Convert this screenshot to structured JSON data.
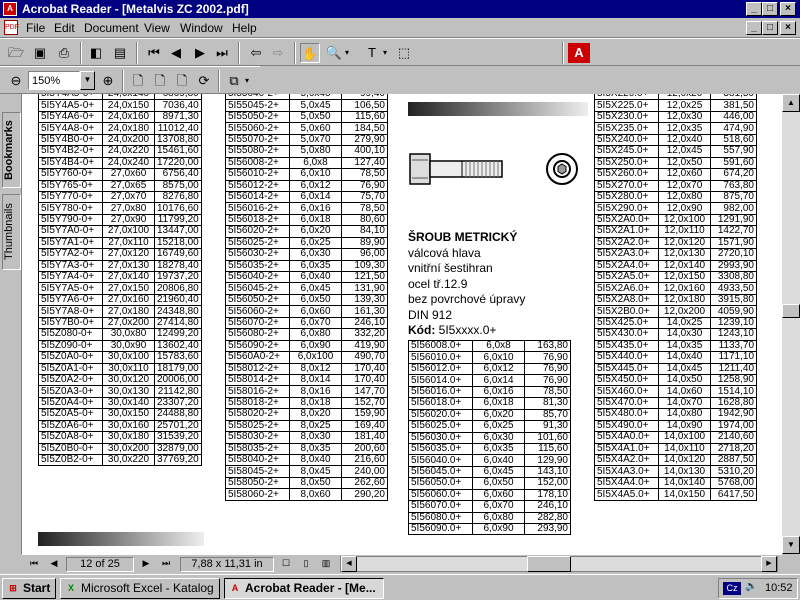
{
  "window": {
    "title": "Acrobat Reader - [Metalvis ZC 2002.pdf]"
  },
  "menu": [
    "File",
    "Edit",
    "Document",
    "View",
    "Window",
    "Help"
  ],
  "zoom": {
    "value": "150%"
  },
  "nav_tabs": [
    "Bookmarks",
    "Thumbnails"
  ],
  "status": {
    "page": "12 of 25",
    "size": "7,88 x 11,31 in"
  },
  "taskbar": {
    "start": "Start",
    "items": [
      "Microsoft Excel - Katalog",
      "Acrobat Reader - [Me..."
    ],
    "lang": "Cz",
    "time": "10:52"
  },
  "product": {
    "title": "ŠROUB METRICKÝ",
    "lines": [
      "válcová hlava",
      "vnitřní šestihran",
      "ocel tř.12.9",
      "bez povrchové úpravy",
      "DIN 912"
    ],
    "code_label": "Kód:",
    "code_value": "5I5xxxx.0+"
  },
  "col1": [
    [
      "5I5Y4A5-0+",
      "24,0x140",
      "6869,80"
    ],
    [
      "5I5Y4A5-0+",
      "24,0x150",
      "7036,40"
    ],
    [
      "5I5Y4A6-0+",
      "24,0x160",
      "8971,30"
    ],
    [
      "5I5Y4A8-0+",
      "24,0x180",
      "11012,40"
    ],
    [
      "5I5Y4B0-0+",
      "24,0x200",
      "13708,80"
    ],
    [
      "5I5Y4B2-0+",
      "24,0x220",
      "15461,60"
    ],
    [
      "5I5Y4B4-0+",
      "24,0x240",
      "17220,00"
    ],
    [
      "5I5Y760-0+",
      "27,0x60",
      "6756,40"
    ],
    [
      "5I5Y765-0+",
      "27,0x65",
      "8575,00"
    ],
    [
      "5I5Y770-0+",
      "27,0x70",
      "8276,80"
    ],
    [
      "5I5Y780-0+",
      "27,0x80",
      "10176,60"
    ],
    [
      "5I5Y790-0+",
      "27,0x90",
      "11799,20"
    ],
    [
      "5I5Y7A0-0+",
      "27,0x100",
      "13447,00"
    ],
    [
      "5I5Y7A1-0+",
      "27,0x110",
      "15218,00"
    ],
    [
      "5I5Y7A2-0+",
      "27,0x120",
      "16749,60"
    ],
    [
      "5I5Y7A3-0+",
      "27,0x130",
      "18278,40"
    ],
    [
      "5I5Y7A4-0+",
      "27,0x140",
      "19737,20"
    ],
    [
      "5I5Y7A5-0+",
      "27,0x150",
      "20806,80"
    ],
    [
      "5I5Y7A6-0+",
      "27,0x160",
      "21960,40"
    ],
    [
      "5I5Y7A8-0+",
      "27,0x180",
      "24348,80"
    ],
    [
      "5I5Y7B0-0+",
      "27,0x200",
      "27414,80"
    ],
    [
      "5I5Z080-0+",
      "30,0x80",
      "12499,20"
    ],
    [
      "5I5Z090-0+",
      "30,0x90",
      "13602,40"
    ],
    [
      "5I5Z0A0-0+",
      "30,0x100",
      "15783,60"
    ],
    [
      "5I5Z0A1-0+",
      "30,0x110",
      "18179,00"
    ],
    [
      "5I5Z0A2-0+",
      "30,0x120",
      "20006,00"
    ],
    [
      "5I5Z0A3-0+",
      "30,0x130",
      "21142,80"
    ],
    [
      "5I5Z0A4-0+",
      "30,0x140",
      "23307,20"
    ],
    [
      "5I5Z0A5-0+",
      "30,0x150",
      "24488,80"
    ],
    [
      "5I5Z0A6-0+",
      "30,0x160",
      "25701,20"
    ],
    [
      "5I5Z0A8-0+",
      "30,0x180",
      "31539,20"
    ],
    [
      "5I5Z0B0-0+",
      "30,0x200",
      "32879,00"
    ],
    [
      "5I5Z0B2-0+",
      "30,0x220",
      "37769,20"
    ]
  ],
  "col2": [
    [
      "5I55040-2+",
      "5,0x40",
      "99,40"
    ],
    [
      "5I55045-2+",
      "5,0x45",
      "106,50"
    ],
    [
      "5I55050-2+",
      "5,0x50",
      "115,60"
    ],
    [
      "5I55060-2+",
      "5,0x60",
      "184,50"
    ],
    [
      "5I55070-2+",
      "5,0x70",
      "279,90"
    ],
    [
      "5I55080-2+",
      "5,0x80",
      "400,10"
    ],
    [
      "5I56008-2+",
      "6,0x8",
      "127,40"
    ],
    [
      "5I56010-2+",
      "6,0x10",
      "78,50"
    ],
    [
      "5I56012-2+",
      "6,0x12",
      "76,90"
    ],
    [
      "5I56014-2+",
      "6,0x14",
      "75,70"
    ],
    [
      "5I56016-2+",
      "6,0x16",
      "78,50"
    ],
    [
      "5I56018-2+",
      "6,0x18",
      "80,60"
    ],
    [
      "5I56020-2+",
      "6,0x20",
      "84,10"
    ],
    [
      "5I56025-2+",
      "6,0x25",
      "89,90"
    ],
    [
      "5I56030-2+",
      "6,0x30",
      "96,00"
    ],
    [
      "5I56035-2+",
      "6,0x35",
      "109,30"
    ],
    [
      "5I56040-2+",
      "6,0x40",
      "121,50"
    ],
    [
      "5I56045-2+",
      "6,0x45",
      "131,90"
    ],
    [
      "5I56050-2+",
      "6,0x50",
      "139,30"
    ],
    [
      "5I56060-2+",
      "6,0x60",
      "161,30"
    ],
    [
      "5I56070-2+",
      "6,0x70",
      "246,10"
    ],
    [
      "5I56080-2+",
      "6,0x80",
      "332,20"
    ],
    [
      "5I56090-2+",
      "6,0x90",
      "419,90"
    ],
    [
      "5I560A0-2+",
      "6,0x100",
      "490,70"
    ],
    [
      "5I58012-2+",
      "8,0x12",
      "170,40"
    ],
    [
      "5I58014-2+",
      "8,0x14",
      "170,40"
    ],
    [
      "5I58016-2+",
      "8,0x16",
      "147,70"
    ],
    [
      "5I58018-2+",
      "8,0x18",
      "152,70"
    ],
    [
      "5I58020-2+",
      "8,0x20",
      "159,90"
    ],
    [
      "5I58025-2+",
      "8,0x25",
      "169,40"
    ],
    [
      "5I58030-2+",
      "8,0x30",
      "181,40"
    ],
    [
      "5I58035-2+",
      "8,0x35",
      "200,60"
    ],
    [
      "5I58040-2+",
      "8,0x40",
      "216,60"
    ],
    [
      "5I58045-2+",
      "8,0x45",
      "240,00"
    ],
    [
      "5I58050-2+",
      "8,0x50",
      "262,60"
    ],
    [
      "5I58060-2+",
      "8,0x60",
      "290,20"
    ]
  ],
  "col3": [
    [
      "5I56008.0+",
      "6,0x8",
      "163,80"
    ],
    [
      "5I56010.0+",
      "6,0x10",
      "76,90"
    ],
    [
      "5I56012.0+",
      "6,0x12",
      "76,90"
    ],
    [
      "5I56014.0+",
      "6,0x14",
      "76,90"
    ],
    [
      "5I56016.0+",
      "6,0x16",
      "78,50"
    ],
    [
      "5I56018.0+",
      "6,0x18",
      "81,30"
    ],
    [
      "5I56020.0+",
      "6,0x20",
      "85,70"
    ],
    [
      "5I56025.0+",
      "6,0x25",
      "91,30"
    ],
    [
      "5I56030.0+",
      "6,0x30",
      "101,60"
    ],
    [
      "5I56035.0+",
      "6,0x35",
      "115,60"
    ],
    [
      "5I56040.0+",
      "6,0x40",
      "129,90"
    ],
    [
      "5I56045.0+",
      "6,0x45",
      "143,10"
    ],
    [
      "5I56050.0+",
      "6,0x50",
      "152,00"
    ],
    [
      "5I56060.0+",
      "6,0x60",
      "178,10"
    ],
    [
      "5I56070.0+",
      "6,0x70",
      "246,10"
    ],
    [
      "5I56080.0+",
      "6,0x80",
      "282,80"
    ],
    [
      "5I56090.0+",
      "6,0x90",
      "293,90"
    ]
  ],
  "col4": [
    [
      "5I5X220.0+",
      "12,0x20",
      "381,50"
    ],
    [
      "5I5X225.0+",
      "12,0x25",
      "381,50"
    ],
    [
      "5I5X230.0+",
      "12,0x30",
      "446,00"
    ],
    [
      "5I5X235.0+",
      "12,0x35",
      "474,90"
    ],
    [
      "5I5X240.0+",
      "12,0x40",
      "518,60"
    ],
    [
      "5I5X245.0+",
      "12,0x45",
      "557,90"
    ],
    [
      "5I5X250.0+",
      "12,0x50",
      "591,60"
    ],
    [
      "5I5X260.0+",
      "12,0x60",
      "674,20"
    ],
    [
      "5I5X270.0+",
      "12,0x70",
      "763,80"
    ],
    [
      "5I5X280.0+",
      "12,0x80",
      "875,70"
    ],
    [
      "5I5X290.0+",
      "12,0x90",
      "982,00"
    ],
    [
      "5I5X2A0.0+",
      "12,0x100",
      "1291,90"
    ],
    [
      "5I5X2A1.0+",
      "12,0x110",
      "1422,70"
    ],
    [
      "5I5X2A2.0+",
      "12,0x120",
      "1571,90"
    ],
    [
      "5I5X2A3.0+",
      "12,0x130",
      "2720,10"
    ],
    [
      "5I5X2A4.0+",
      "12,0x140",
      "2993,90"
    ],
    [
      "5I5X2A5.0+",
      "12,0x150",
      "3308,80"
    ],
    [
      "5I5X2A6.0+",
      "12,0x160",
      "4933,50"
    ],
    [
      "5I5X2A8.0+",
      "12,0x180",
      "3915,80"
    ],
    [
      "5I5X2B0.0+",
      "12,0x200",
      "4059,90"
    ],
    [
      "5I5X425.0+",
      "14,0x25",
      "1239,10"
    ],
    [
      "5I5X430.0+",
      "14,0x30",
      "1243,10"
    ],
    [
      "5I5X435.0+",
      "14,0x35",
      "1133,70"
    ],
    [
      "5I5X440.0+",
      "14,0x40",
      "1171,10"
    ],
    [
      "5I5X445.0+",
      "14,0x45",
      "1211,40"
    ],
    [
      "5I5X450.0+",
      "14,0x50",
      "1258,90"
    ],
    [
      "5I5X460.0+",
      "14,0x60",
      "1514,10"
    ],
    [
      "5I5X470.0+",
      "14,0x70",
      "1628,80"
    ],
    [
      "5I5X480.0+",
      "14,0x80",
      "1942,90"
    ],
    [
      "5I5X490.0+",
      "14,0x90",
      "1974,00"
    ],
    [
      "5I5X4A0.0+",
      "14,0x100",
      "2140,60"
    ],
    [
      "5I5X4A1.0+",
      "14,0x110",
      "2718,20"
    ],
    [
      "5I5X4A2.0+",
      "14,0x120",
      "2887,50"
    ],
    [
      "5I5X4A3.0+",
      "14,0x130",
      "5310,20"
    ],
    [
      "5I5X4A4.0+",
      "14,0x140",
      "5768,00"
    ],
    [
      "5I5X4A5.0+",
      "14,0x150",
      "6417,50"
    ]
  ]
}
